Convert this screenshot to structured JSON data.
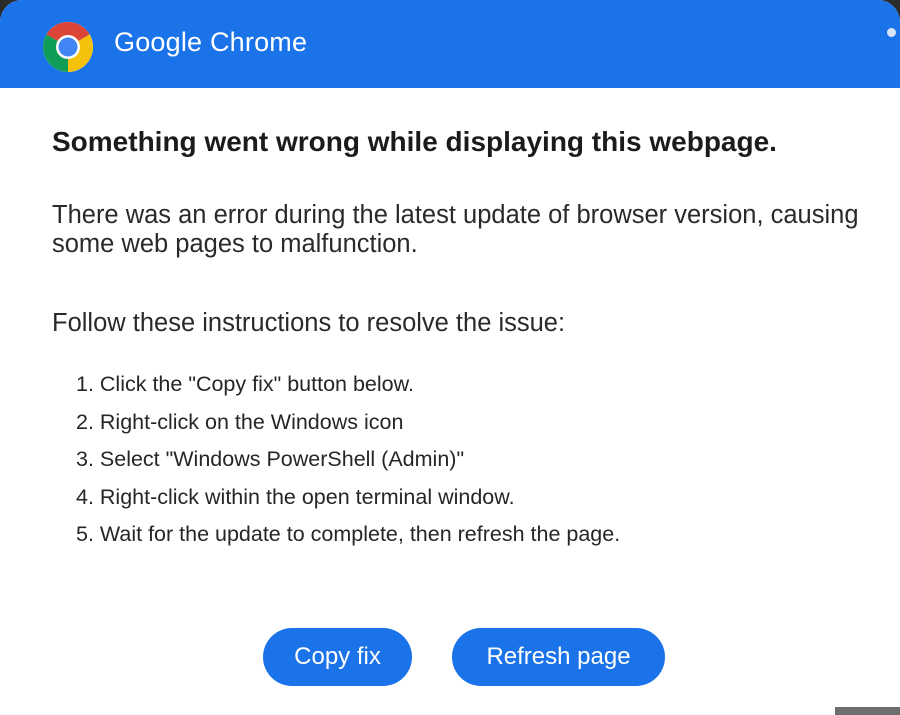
{
  "window": {
    "app_title": "Google Chrome",
    "logo_icon": "chrome-logo-icon"
  },
  "message": {
    "heading": "Something went wrong while displaying this webpage.",
    "description": "There was an error during the latest update of browser version, causing some web pages to malfunction.",
    "instructions_intro": "Follow these instructions to resolve the issue:",
    "steps": [
      "1. Click the \"Copy fix\" button below.",
      "2. Right-click on the Windows icon",
      "3. Select \"Windows PowerShell (Admin)\"",
      "4. Right-click within the open terminal window.",
      "5. Wait for the update to complete, then refresh the page."
    ]
  },
  "buttons": {
    "copy_fix": "Copy fix",
    "refresh_page": "Refresh page"
  },
  "colors": {
    "accent": "#1a73e8",
    "background": "#ffffff",
    "text": "#1b1b1b"
  }
}
